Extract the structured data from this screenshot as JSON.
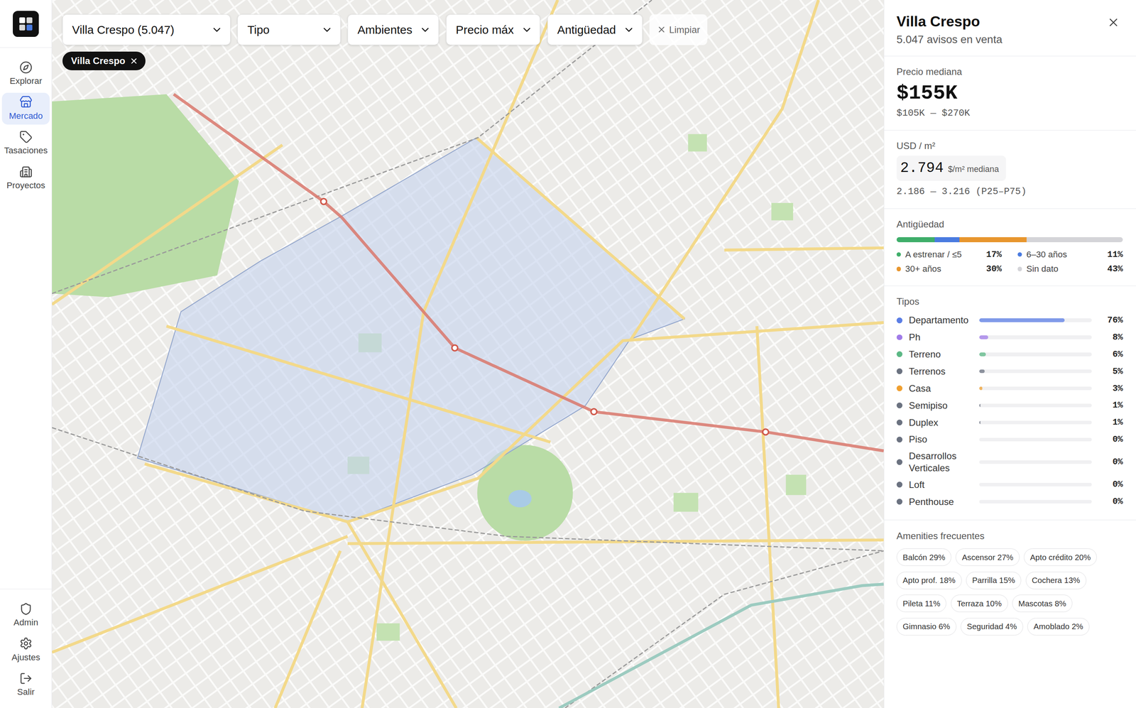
{
  "sidebar": {
    "items": [
      {
        "label": "Explorar",
        "selected": false
      },
      {
        "label": "Mercado",
        "selected": true
      },
      {
        "label": "Tasaciones",
        "selected": false
      },
      {
        "label": "Proyectos",
        "selected": false
      }
    ],
    "bottom_items": [
      {
        "label": "Admin"
      },
      {
        "label": "Ajustes"
      },
      {
        "label": "Salir"
      }
    ]
  },
  "toolbar": {
    "filters": [
      {
        "label": "Villa Crespo (5.047)"
      },
      {
        "label": "Tipo"
      },
      {
        "label": "Ambientes"
      },
      {
        "label": "Precio máx"
      },
      {
        "label": "Antigüedad"
      }
    ],
    "clear_button": "Limpiar"
  },
  "map": {
    "chips": [
      {
        "label": "Villa Crespo"
      }
    ]
  },
  "panel": {
    "title": "Villa Crespo",
    "subtitle": "5.047 avisos en venta",
    "price": {
      "label": "Precio mediana",
      "value": "$155K",
      "range": "$105K — $270K"
    },
    "usd_m2": {
      "label": "USD / m²",
      "value": "2.794",
      "unit": "$/m² mediana",
      "range": "2.186 — 3.216 (P25–P75)"
    },
    "age": {
      "label": "Antigüedad",
      "segments": [
        {
          "label": "A estrenar / ≤5",
          "value": "17%",
          "level": 0.17,
          "color": "#3fae6a"
        },
        {
          "label": "6–30 años",
          "value": "11%",
          "level": 0.11,
          "color": "#4a7be0"
        },
        {
          "label": "30+ años",
          "value": "30%",
          "level": 0.3,
          "color": "#e8962e"
        },
        {
          "label": "Sin dato",
          "value": "43%",
          "level": 0.43,
          "color": "#d4d4d8"
        }
      ]
    },
    "types": {
      "label": "Tipos",
      "items": [
        {
          "name": "Departamento",
          "value": "76%",
          "level": 0.76,
          "color": "#5b7ee5"
        },
        {
          "name": "Ph",
          "value": "8%",
          "level": 0.08,
          "color": "#a07be8"
        },
        {
          "name": "Terreno",
          "value": "6%",
          "level": 0.06,
          "color": "#5cb885"
        },
        {
          "name": "Terrenos",
          "value": "5%",
          "level": 0.05,
          "color": "#6b7280"
        },
        {
          "name": "Casa",
          "value": "3%",
          "level": 0.03,
          "color": "#f0a030"
        },
        {
          "name": "Semipiso",
          "value": "1%",
          "level": 0.01,
          "color": "#6b7280"
        },
        {
          "name": "Duplex",
          "value": "1%",
          "level": 0.01,
          "color": "#6b7280"
        },
        {
          "name": "Piso",
          "value": "0%",
          "level": 0,
          "color": "#6b7280"
        },
        {
          "name": "Desarrollos Verticales",
          "value": "0%",
          "level": 0,
          "color": "#6b7280"
        },
        {
          "name": "Loft",
          "value": "0%",
          "level": 0,
          "color": "#6b7280"
        },
        {
          "name": "Penthouse",
          "value": "0%",
          "level": 0,
          "color": "#6b7280"
        }
      ]
    },
    "amenities": {
      "label": "Amenities frecuentes",
      "items": [
        "Balcón 29%",
        "Ascensor 27%",
        "Apto crédito 20%",
        "Apto prof. 18%",
        "Parrilla 15%",
        "Cochera 13%",
        "Pileta 11%",
        "Terraza 10%",
        "Mascotas 8%",
        "Gimnasio 6%",
        "Seguridad 4%",
        "Amoblado 2%"
      ]
    }
  }
}
